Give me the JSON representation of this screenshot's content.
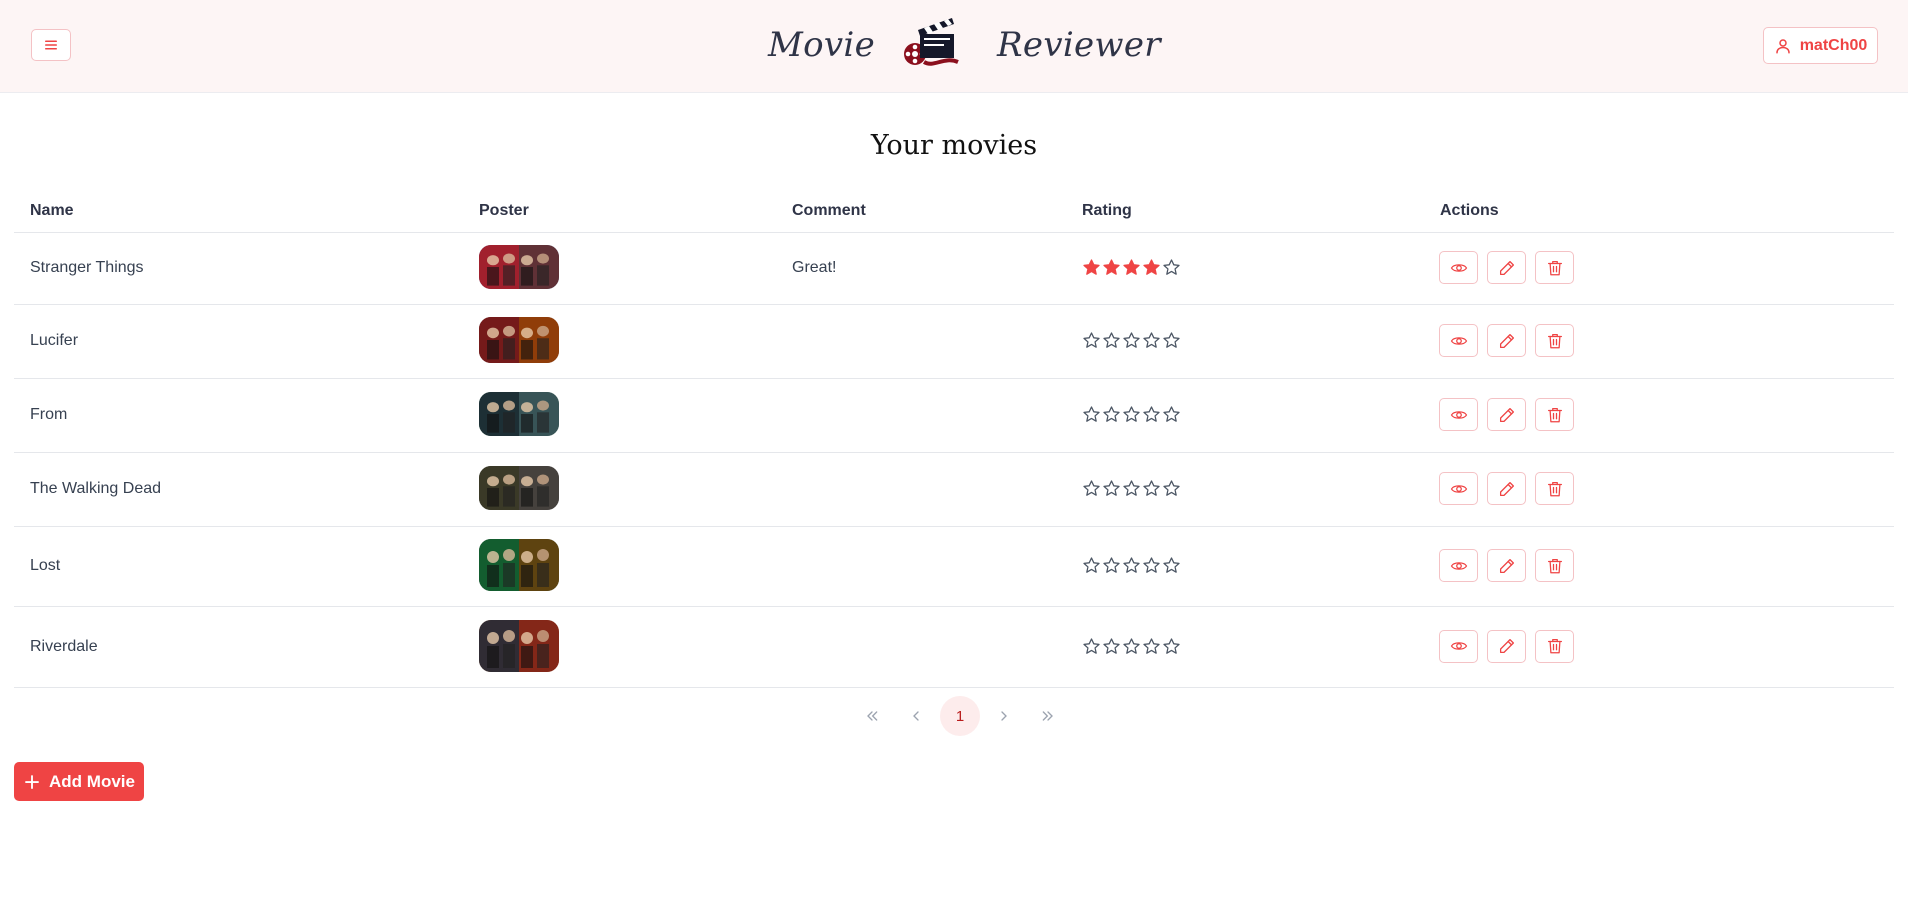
{
  "header": {
    "brand_left": "Movie",
    "brand_right": "Reviewer",
    "user_name": "matCh00"
  },
  "page_title": "Your movies",
  "table": {
    "columns": [
      "Name",
      "Poster",
      "Comment",
      "Rating",
      "Actions"
    ],
    "rows": [
      {
        "name": "Stranger Things",
        "comment": "Great!",
        "rating": 4,
        "max_rating": 5
      },
      {
        "name": "Lucifer",
        "comment": "",
        "rating": 0,
        "max_rating": 5
      },
      {
        "name": "From",
        "comment": "",
        "rating": 0,
        "max_rating": 5
      },
      {
        "name": "The Walking Dead",
        "comment": "",
        "rating": 0,
        "max_rating": 5
      },
      {
        "name": "Lost",
        "comment": "",
        "rating": 0,
        "max_rating": 5
      },
      {
        "name": "Riverdale",
        "comment": "",
        "rating": 0,
        "max_rating": 5
      }
    ]
  },
  "pagination": {
    "current_page": "1"
  },
  "add_button": {
    "label": "Add Movie"
  },
  "colors": {
    "accent": "#ef4444",
    "accent_border": "#f4c2c5",
    "header_bg": "#fdf5f5",
    "star_empty": "#4b5563"
  },
  "icons": {
    "menu": "menu-icon",
    "user": "user-icon",
    "view": "eye-icon",
    "edit": "pencil-icon",
    "delete": "trash-icon",
    "add": "plus-icon"
  }
}
